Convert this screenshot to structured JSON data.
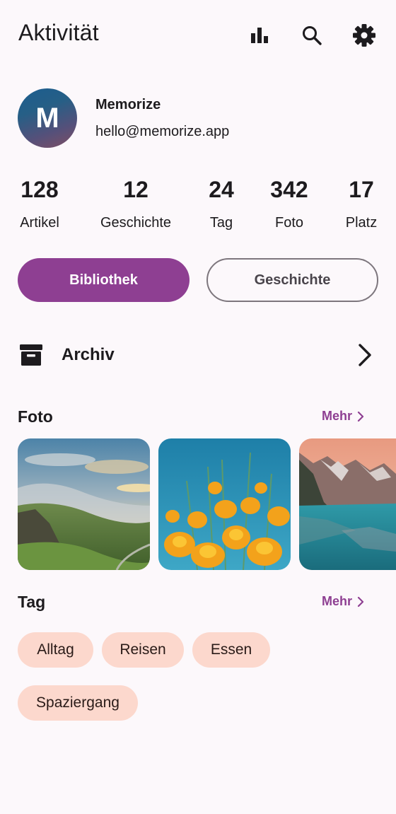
{
  "header": {
    "title": "Aktivität",
    "icons": [
      "bar-chart-icon",
      "search-icon",
      "settings-icon"
    ]
  },
  "profile": {
    "initial": "M",
    "name": "Memorize",
    "email": "hello@memorize.app"
  },
  "stats": [
    {
      "value": "128",
      "label": "Artikel"
    },
    {
      "value": "12",
      "label": "Geschichte"
    },
    {
      "value": "24",
      "label": "Tag"
    },
    {
      "value": "342",
      "label": "Foto"
    },
    {
      "value": "17",
      "label": "Platz"
    }
  ],
  "tabs": {
    "primary": "Bibliothek",
    "secondary": "Geschichte"
  },
  "archive": {
    "label": "Archiv"
  },
  "photos": {
    "title": "Foto",
    "more": "Mehr"
  },
  "tags": {
    "title": "Tag",
    "more": "Mehr",
    "items": [
      "Alltag",
      "Reisen",
      "Essen",
      "Spaziergang"
    ]
  },
  "colors": {
    "accent": "#8e3f92",
    "chip": "#fcd8cd",
    "background": "#fcf8fb"
  }
}
